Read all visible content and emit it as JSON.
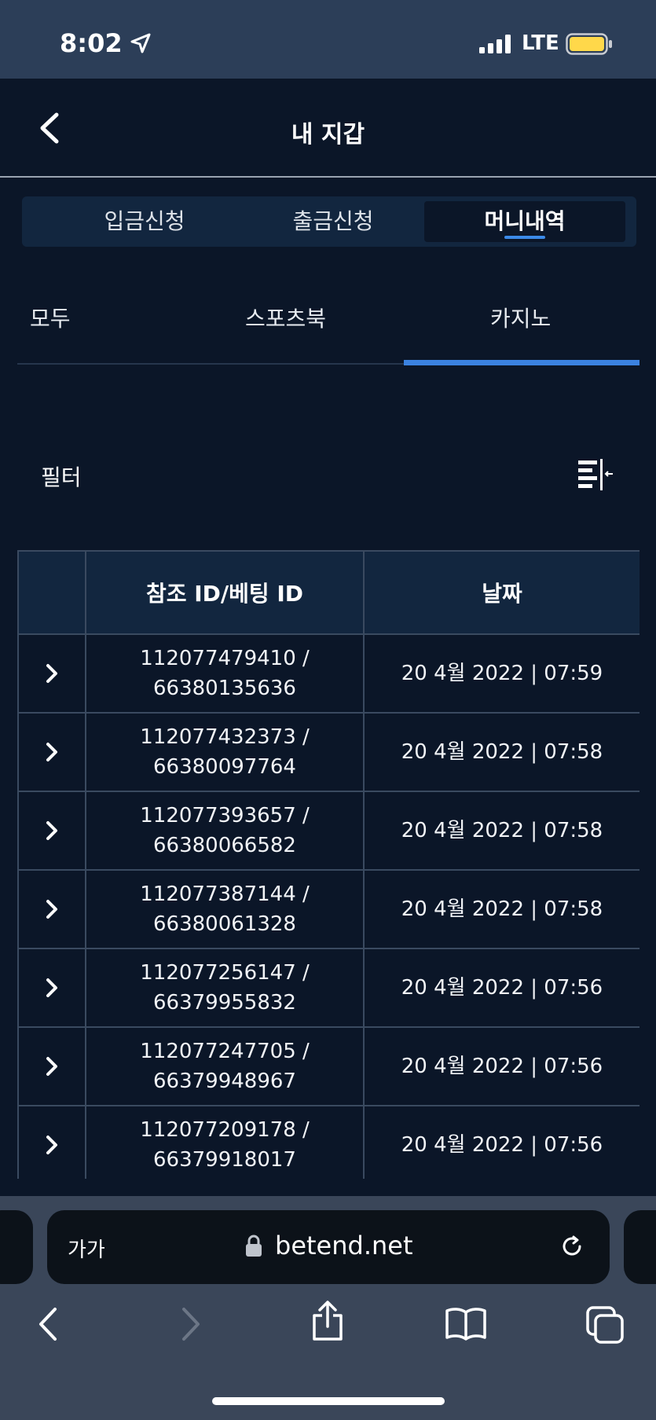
{
  "status": {
    "time": "8:02",
    "network": "LTE"
  },
  "header": {
    "title": "내 지갑"
  },
  "segments": [
    {
      "label": "입금신청",
      "active": false
    },
    {
      "label": "출금신청",
      "active": false
    },
    {
      "label": "머니내역",
      "active": true
    }
  ],
  "tabs": [
    {
      "label": "모두",
      "active": false
    },
    {
      "label": "스포츠북",
      "active": false
    },
    {
      "label": "카지노",
      "active": true
    }
  ],
  "filter": {
    "label": "필터"
  },
  "table": {
    "columns": [
      "",
      "참조 ID/베팅 ID",
      "날짜"
    ],
    "rows": [
      {
        "ref": "112077479410 /",
        "bet": "66380135636",
        "date": "20 4월 2022 | 07:59"
      },
      {
        "ref": "112077432373 /",
        "bet": "66380097764",
        "date": "20 4월 2022 | 07:58"
      },
      {
        "ref": "112077393657 /",
        "bet": "66380066582",
        "date": "20 4월 2022 | 07:58"
      },
      {
        "ref": "112077387144 /",
        "bet": "66380061328",
        "date": "20 4월 2022 | 07:58"
      },
      {
        "ref": "112077256147 /",
        "bet": "66379955832",
        "date": "20 4월 2022 | 07:56"
      },
      {
        "ref": "112077247705 /",
        "bet": "66379948967",
        "date": "20 4월 2022 | 07:56"
      },
      {
        "ref": "112077209178 /",
        "bet": "66379918017",
        "date": "20 4월 2022 | 07:56"
      }
    ]
  },
  "browser": {
    "aa_label": "가가",
    "url": "betend.net"
  },
  "colors": {
    "background": "#0b1628",
    "accent": "#3b82e0",
    "battery": "#ffd84a"
  }
}
